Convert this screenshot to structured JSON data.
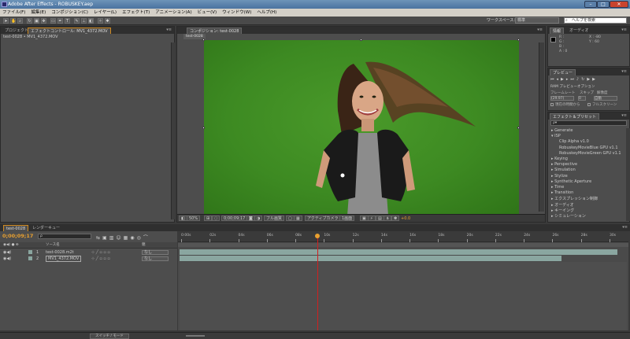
{
  "window": {
    "title": "Adobe After Effects - ROBUSKEY.aep",
    "min": "–",
    "max": "□",
    "close": "✕"
  },
  "menu": [
    "ファイル(F)",
    "編集(E)",
    "コンポジション(C)",
    "レイヤー(L)",
    "エフェクト(T)",
    "アニメーション(A)",
    "ビュー(V)",
    "ウィンドウ(W)",
    "ヘルプ(H)"
  ],
  "toolbar": {
    "workspace_label": "ワークスペース：",
    "workspace_value": "標準",
    "help_search": "ヘルプを検索"
  },
  "project_panel": {
    "tabs": [
      "プロジェクト",
      "エフェクトコントロール: MV1_4372.MOV"
    ],
    "path": "test-0028 • MV1_4372.MOV"
  },
  "comp_panel": {
    "tab": "コンポジション: test-0028",
    "sub_tab": "test-0028",
    "zoom": "50%",
    "timecode": "0;00;09;17",
    "resolution": "フル画質",
    "camera": "アクティブカメラ",
    "views": "1画面",
    "offset": "+0.0"
  },
  "info_panel": {
    "tabs": [
      "情報",
      "オーディオ"
    ],
    "r": "R :",
    "g": "G :",
    "b": "B :",
    "a": "A : 0",
    "x": "X : -80",
    "y": "Y : 60"
  },
  "preview_panel": {
    "title": "プレビュー",
    "ram_options": "RAM プレビューオプション",
    "framerate_label": "フレームレート",
    "skip_label": "スキップ",
    "resolution_label": "解像度",
    "framerate_value": "(29.97)",
    "skip_value": "0",
    "resolution_value": "自動",
    "from_current": "現在の時間から",
    "fullscreen": "フルスクリーン"
  },
  "effects_panel": {
    "title": "エフェクト＆プリセット",
    "search_placeholder": "ρ▾",
    "items": [
      {
        "label": "▸ Generate",
        "indent": 0
      },
      {
        "label": "▾ ISP",
        "indent": 0
      },
      {
        "label": "Clip Alpha v1.0",
        "indent": 1
      },
      {
        "label": "RobuskeyMovieBlue GPU v1.1",
        "indent": 1
      },
      {
        "label": "RobuskeyMovieGreen GPU v1.1",
        "indent": 1
      },
      {
        "label": "▸ Keying",
        "indent": 0
      },
      {
        "label": "▸ Perspective",
        "indent": 0
      },
      {
        "label": "▸ Simulation",
        "indent": 0
      },
      {
        "label": "▸ Stylize",
        "indent": 0
      },
      {
        "label": "▸ Synthetic Aperture",
        "indent": 0
      },
      {
        "label": "▸ Time",
        "indent": 0
      },
      {
        "label": "▸ Transition",
        "indent": 0
      },
      {
        "label": "▸ エクスプレッション制御",
        "indent": 0
      },
      {
        "label": "▸ オーディオ",
        "indent": 0
      },
      {
        "label": "▸ キーイング",
        "indent": 0
      },
      {
        "label": "▸ シミュレーション",
        "indent": 0
      }
    ]
  },
  "timeline": {
    "tabs": [
      "test-0028",
      "レンダーキュー"
    ],
    "timecode": "0;00;09;17",
    "search_placeholder": "ρ",
    "col_source": "ソース名",
    "col_parent": "親",
    "layers": [
      {
        "num": "1",
        "name": "test-0028.m2t",
        "parent": "なし"
      },
      {
        "num": "2",
        "name": "MV1_4372.MOV",
        "parent": "なし"
      }
    ],
    "ticks": [
      "0:00s",
      "02s",
      "04s",
      "06s",
      "08s",
      "10s",
      "12s",
      "14s",
      "16s",
      "18s",
      "20s",
      "22s",
      "24s",
      "26s",
      "28s",
      "30s"
    ],
    "switch_mode": "スイッチ / モード",
    "playhead_fraction": 0.318
  },
  "colors": {
    "accent_orange": "#d08a20",
    "greenscreen": "#3d8a22",
    "track_bar": "#8aa6a0"
  }
}
